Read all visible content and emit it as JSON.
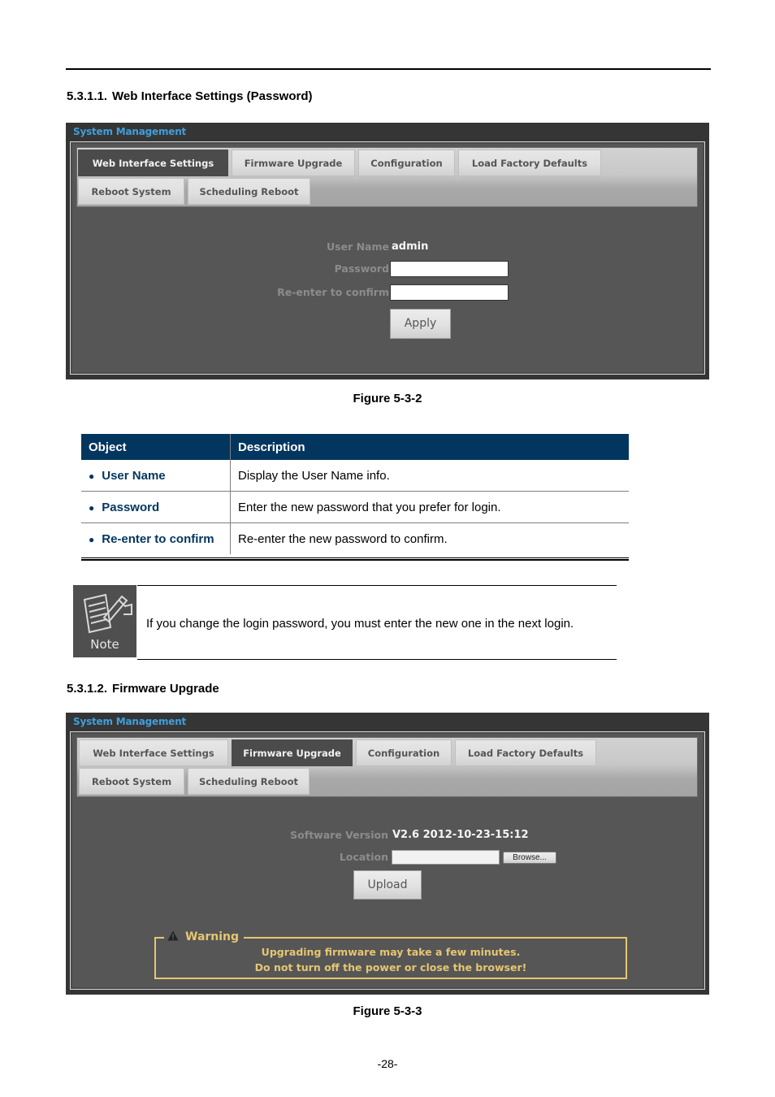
{
  "section1": {
    "number": "5.3.1.1.",
    "title": "Web Interface Settings (Password)",
    "figure": {
      "panel_title": "System Management",
      "tabs": [
        {
          "label": "Web Interface Settings",
          "active": true
        },
        {
          "label": "Firmware Upgrade",
          "active": false
        },
        {
          "label": "Configuration",
          "active": false
        },
        {
          "label": "Load Factory Defaults",
          "active": false
        },
        {
          "label": "Reboot System",
          "active": false
        },
        {
          "label": "Scheduling Reboot",
          "active": false
        }
      ],
      "form": {
        "user_name_label": "User Name",
        "user_name_value": "admin",
        "password_label": "Password",
        "password_value": "",
        "confirm_label": "Re-enter to confirm",
        "confirm_value": "",
        "apply_label": "Apply"
      }
    },
    "caption": "Figure 5-3-2"
  },
  "table": {
    "headers": [
      "Object",
      "Description"
    ],
    "rows": [
      {
        "object": "User Name",
        "description": "Display the User Name info."
      },
      {
        "object": "Password",
        "description": "Enter the new password that you prefer for login."
      },
      {
        "object": "Re-enter to confirm",
        "description": "Re-enter the new password to confirm."
      }
    ]
  },
  "note": {
    "icon_label": "Note",
    "text": "If you change the login password, you must enter the new one in the next login."
  },
  "section2": {
    "number": "5.3.1.2.",
    "title": "Firmware Upgrade",
    "figure": {
      "panel_title": "System Management",
      "tabs": [
        {
          "label": "Web Interface Settings",
          "active": false
        },
        {
          "label": "Firmware Upgrade",
          "active": true
        },
        {
          "label": "Configuration",
          "active": false
        },
        {
          "label": "Load Factory Defaults",
          "active": false
        },
        {
          "label": "Reboot System",
          "active": false
        },
        {
          "label": "Scheduling Reboot",
          "active": false
        }
      ],
      "form": {
        "software_version_label": "Software Version",
        "software_version_value": "V2.6 2012-10-23-15:12",
        "location_label": "Location",
        "location_value": "",
        "browse_label": "Browse...",
        "upload_label": "Upload"
      },
      "warning": {
        "title": "Warning",
        "line1": "Upgrading firmware may take a few minutes.",
        "line2": "Do not turn off the power or close the browser!"
      }
    },
    "caption": "Figure 5-3-3"
  },
  "page_number": "-28-"
}
